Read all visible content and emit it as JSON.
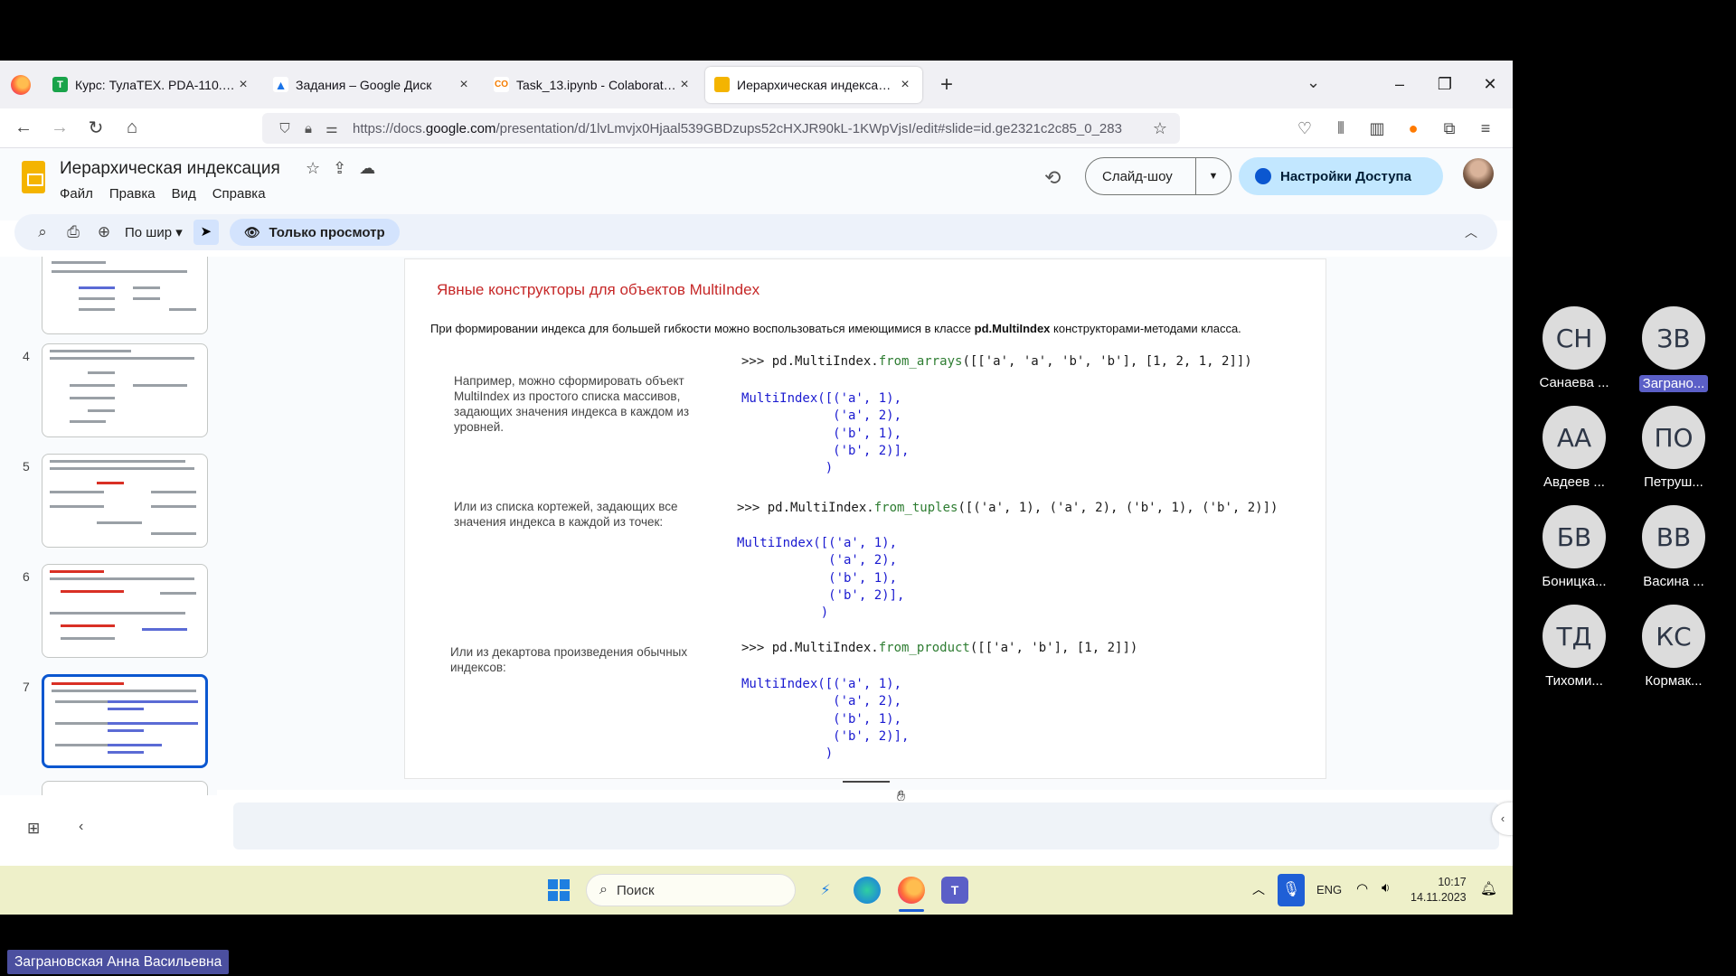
{
  "browser": {
    "tabs": [
      {
        "label": "Курс: ТулаТЕХ. PDA-110. Введе",
        "icon": "tulatex-icon",
        "color": "#19a34a",
        "glyph": "T"
      },
      {
        "label": "Задания – Google Диск",
        "icon": "google-drive-icon",
        "color": "#1a73e8",
        "glyph": "▲"
      },
      {
        "label": "Task_13.ipynb - Colaboratory",
        "icon": "colab-icon",
        "color": "#f9ab00",
        "glyph": "CO"
      },
      {
        "label": "Иерархическая индексация ·",
        "icon": "google-slides-icon",
        "color": "#f4b400",
        "glyph": "▭"
      }
    ],
    "url_prefix": "https://docs.",
    "url_domain": "google.com",
    "url_rest": "/presentation/d/1lvLmvjx0Hjaal539GBDzups52cHXJR90kL-1KWpVjsI/edit#slide=id.ge2321c2c85_0_283"
  },
  "slides_app": {
    "title": "Иерархическая индексация",
    "menu": [
      "Файл",
      "Правка",
      "Вид",
      "Справка"
    ],
    "slideshow_label": "Слайд-шоу",
    "share_label": "Настройки Доступа",
    "zoom_label": "По шир",
    "view_only_label": "Только просмотр"
  },
  "filmstrip": {
    "numbers": [
      "4",
      "5",
      "6",
      "7"
    ],
    "active": "7"
  },
  "slide": {
    "title": "Явные конструкторы для объектов MultiIndex",
    "intro_before": "При формировании индекса для большей гибкости можно воспользоваться имеющимися в классе ",
    "intro_bold": "pd.MultiIndex",
    "intro_after": " конструкторами-методами класса.",
    "text1": "Например, можно сформировать объект MultiIndex из простого списка массивов, задающих значения индекса в каждом из уровней.",
    "text2": "Или из списка кортежей, задающих все значения индекса в каждой из точек:",
    "text3": "Или из декартова произведения обычных индексов:",
    "code1_prompt": ">>> pd.MultiIndex.",
    "code1_fn": "from_arrays",
    "code1_args": "([['a', 'a', 'b', 'b'], [1, 2, 1, 2]])",
    "code2_prompt": ">>> pd.MultiIndex.",
    "code2_fn": "from_tuples",
    "code2_args": "([('a', 1), ('a', 2), ('b', 1), ('b', 2)])",
    "code3_prompt": ">>> pd.MultiIndex.",
    "code3_fn": "from_product",
    "code3_args": "([['a', 'b'], [1, 2]])",
    "result": "MultiIndex([('a', 1),\n            ('a', 2),\n            ('b', 1),\n            ('b', 2)],\n           )"
  },
  "taskbar": {
    "search_label": "Поиск",
    "lang": "ENG",
    "time": "10:17",
    "date": "14.11.2023"
  },
  "participants": [
    {
      "initials": "СН",
      "name": "Санаева ...",
      "highlight": false
    },
    {
      "initials": "ЗВ",
      "name": "Заграно...",
      "highlight": true
    },
    {
      "initials": "АА",
      "name": "Авдеев ...",
      "highlight": false
    },
    {
      "initials": "ПО",
      "name": "Петруш...",
      "highlight": false
    },
    {
      "initials": "БВ",
      "name": "Боницка...",
      "highlight": false
    },
    {
      "initials": "ВВ",
      "name": "Васина ...",
      "highlight": false
    },
    {
      "initials": "ТД",
      "name": "Тихоми...",
      "highlight": false
    },
    {
      "initials": "КС",
      "name": "Кормак...",
      "highlight": false
    }
  ],
  "presenter_name": "Заграновская Анна Васильевна"
}
